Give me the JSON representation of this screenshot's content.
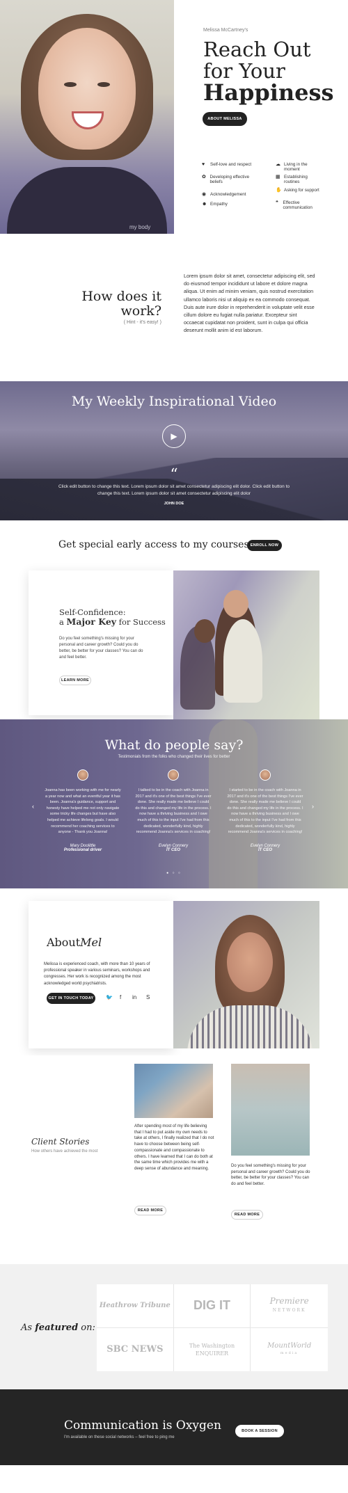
{
  "hero": {
    "kicker": "Melissa McCartney's",
    "title_line1": "Reach Out",
    "title_line2": "for Your",
    "title_line3": "Happiness",
    "button": "ABOUT MELISSA",
    "shirt_text": "my body",
    "features": [
      {
        "icon": "heart-icon",
        "glyph": "♥",
        "label": "Self-love and respect"
      },
      {
        "icon": "cloud-icon",
        "glyph": "☁",
        "label": "Living in the moment"
      },
      {
        "icon": "sprout-icon",
        "glyph": "✿",
        "label": "Developing effective beliefs"
      },
      {
        "icon": "calendar-icon",
        "glyph": "▦",
        "label": "Establishing routines"
      },
      {
        "icon": "eye-icon",
        "glyph": "◉",
        "label": "Acknowledgement"
      },
      {
        "icon": "support-icon",
        "glyph": "✋",
        "label": "Asking for support"
      },
      {
        "icon": "people-icon",
        "glyph": "☻",
        "label": "Empathy"
      },
      {
        "icon": "chat-icon",
        "glyph": "❝",
        "label": "Effective communication"
      }
    ]
  },
  "how": {
    "title_line1": "How does it",
    "title_line2": "work?",
    "hint": "( Hint - it's easy! )",
    "body": "Lorem ipsum dolor sit amet, consectetur adipiscing elit, sed do eiusmod tempor incididunt ut labore et dolore magna aliqua. Ut enim ad minim veniam, quis nostrud exercitation ullamco laboris nisi ut aliquip ex ea commodo consequat. Duis aute irure dolor in reprehenderit in voluptate velit esse cillum dolore eu fugiat nulla pariatur. Excepteur sint occaecat cupidatat non proident, sunt in culpa qui officia deserunt mollit anim id est laborum."
  },
  "video": {
    "title": "My Weekly Inspirational Video",
    "quote_mark": "“",
    "quote": "Click edit button to change this text. Lorem ipsum dolor sit amet consectetur adipiscing elit dolor. Click edit button to change this text. Lorem ipsum dolor sit amet consectetur adipiscing elit dolor",
    "author": "JOHN DOE"
  },
  "early": {
    "title": "Get special early access to my courses",
    "button": "ENROLL NOW"
  },
  "course": {
    "title_line1": "Self-Confidence:",
    "title_pre": "a",
    "title_bold": "Major Key",
    "title_post": "for Success",
    "body": "Do you feel something's missing for your personal and career growth? Could you do better, be better for your classes? You can do and feel better.",
    "button": "LEARN MORE"
  },
  "testimonials": {
    "title": "What do people say?",
    "subtitle": "Testimonials from the folks who changed their lives for better",
    "items": [
      {
        "text": "Joanna has been working with me for nearly a year now and what an eventful year it has been. Joanna's guidance, support and honesty have helped me not only navigate some tricky life changes but have also helped me achieve lifelong goals. I would recommend her coaching services to anyone - Thank you Joanna!",
        "name": "Mary Doolittle",
        "role": "Professional driver"
      },
      {
        "text": "I talked to be in the coach with Joanna in 2017 and it's one of the best things I've ever done. She really made me believe I could do this and changed my life in the process. I now have a thriving business and I owe much of this to the input I've had from this dedicated, wonderfully kind, highly recommend Joanna's services in coaching!",
        "name": "Evelyn Connery",
        "role": "IT CEO"
      },
      {
        "text": "I started to be in the coach with Joanna in 2017 and it's one of the best things I've ever done. She really made me believe I could do this and changed my life in the process. I now have a thriving business and I owe much of this to the input I've had from this dedicated, wonderfully kind, highly recommend Joanna's services in coaching!",
        "name": "Evelyn Connery",
        "role": "IT CEO"
      }
    ],
    "prev": "‹",
    "next": "›",
    "dots": "● ○ ○"
  },
  "about": {
    "title_about": "About",
    "title_name": "Mel",
    "body": "Melissa is experienced coach, with more than 10 years of professional speaker in various seminars, workshops and congresses. Her work is recognized among the most acknowledged world psychiatrists.",
    "button": "GET IN TOUCH TODAY",
    "social": [
      {
        "icon": "twitter-icon",
        "glyph": "🐦"
      },
      {
        "icon": "facebook-icon",
        "glyph": "f"
      },
      {
        "icon": "linkedin-icon",
        "glyph": "in"
      },
      {
        "icon": "skype-icon",
        "glyph": "S"
      }
    ]
  },
  "stories": {
    "title": "Client Stories",
    "subtitle": "How others have achieved the most",
    "story1": "After spending most of my life believing that I had to put aside my own needs to take at others, I finally realized that I do not have to choose between being self-compassionate and compassionate to others. I have learned that I can do both at the same time which provides me with a deep sense of abundance and meaning.",
    "story2": "Do you feel something's missing for your personal and career growth? Could you do better, be better for your classes? You can do and feel better.",
    "button": "READ MORE"
  },
  "featured": {
    "title_pre": "As",
    "title_bold": "featured",
    "title_post": "on:",
    "logos": [
      {
        "name": "heathrow-tribune-logo",
        "text": "Heathrow Tribune",
        "sub": ""
      },
      {
        "name": "dig-it-logo",
        "text": "DIG IT",
        "sub": ""
      },
      {
        "name": "premiere-network-logo",
        "text": "Premiere",
        "sub": "NETWORK"
      },
      {
        "name": "sbc-news-logo",
        "text": "SBC NEWS",
        "sub": ""
      },
      {
        "name": "washington-enquirer-logo",
        "text": "The Washington ENQUIRER",
        "sub": ""
      },
      {
        "name": "mountworld-media-logo",
        "text": "MountWorld",
        "sub": "media"
      }
    ]
  },
  "cta": {
    "title": "Communication is Oxygen",
    "subtitle": "I'm available on these social networks – feel free to ping me",
    "button": "BOOK A SESSION"
  }
}
